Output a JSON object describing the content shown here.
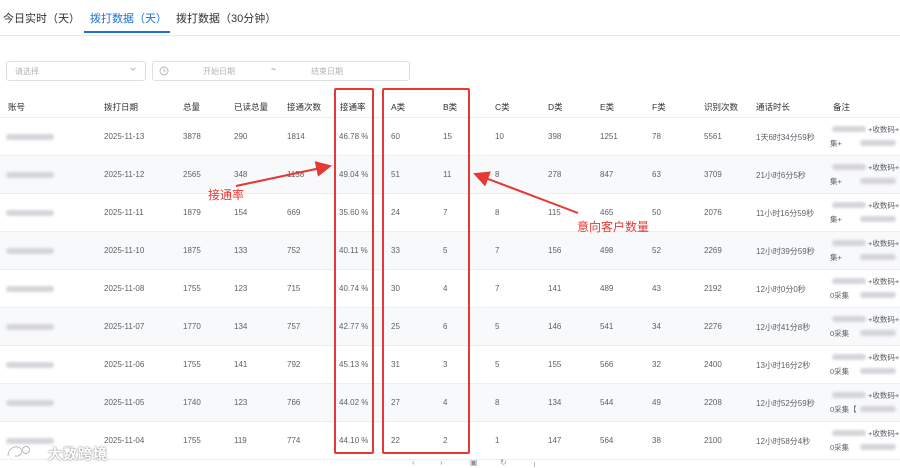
{
  "tabs": [
    {
      "label": "今日实时（天）",
      "active": false
    },
    {
      "label": "拨打数据（天）",
      "active": true
    },
    {
      "label": "拨打数据（30分钟）",
      "active": false
    }
  ],
  "filters": {
    "select_placeholder": "请选择",
    "date_start_placeholder": "开始日期",
    "date_separator": "~",
    "date_end_placeholder": "结束日期"
  },
  "table": {
    "columns": [
      "账号",
      "拨打日期",
      "总量",
      "已读总量",
      "接通次数",
      "接通率",
      "A类",
      "B类",
      "C类",
      "D类",
      "E类",
      "F类",
      "识别次数",
      "通话时长",
      "备注"
    ],
    "rows": [
      {
        "date": "2025-11-13",
        "total": "3878",
        "read": "290",
        "connected": "1814",
        "rate": "46.78 %",
        "a": "60",
        "b": "15",
        "c": "10",
        "d": "398",
        "e": "1251",
        "f": "78",
        "recog": "5561",
        "duration": "1天6时34分59秒",
        "remark1": "+收数码+",
        "remark2": "集+"
      },
      {
        "date": "2025-11-12",
        "total": "2565",
        "read": "348",
        "connected": "1158",
        "rate": "49.04 %",
        "a": "51",
        "b": "11",
        "c": "8",
        "d": "278",
        "e": "847",
        "f": "63",
        "recog": "3709",
        "duration": "21小时6分5秒",
        "remark1": "+收数码+",
        "remark2": "集+"
      },
      {
        "date": "2025-11-11",
        "total": "1879",
        "read": "154",
        "connected": "669",
        "rate": "35.60 %",
        "a": "24",
        "b": "7",
        "c": "8",
        "d": "115",
        "e": "465",
        "f": "50",
        "recog": "2076",
        "duration": "11小时16分59秒",
        "remark1": "+收数码+",
        "remark2": "集+"
      },
      {
        "date": "2025-11-10",
        "total": "1875",
        "read": "133",
        "connected": "752",
        "rate": "40.11 %",
        "a": "33",
        "b": "5",
        "c": "7",
        "d": "156",
        "e": "498",
        "f": "52",
        "recog": "2269",
        "duration": "12小时39分59秒",
        "remark1": "+收数码+",
        "remark2": "集+"
      },
      {
        "date": "2025-11-08",
        "total": "1755",
        "read": "123",
        "connected": "715",
        "rate": "40.74 %",
        "a": "30",
        "b": "4",
        "c": "7",
        "d": "141",
        "e": "489",
        "f": "43",
        "recog": "2192",
        "duration": "12小时0分0秒",
        "remark1": "+收数码+",
        "remark2": "0采集"
      },
      {
        "date": "2025-11-07",
        "total": "1770",
        "read": "134",
        "connected": "757",
        "rate": "42.77 %",
        "a": "25",
        "b": "6",
        "c": "5",
        "d": "146",
        "e": "541",
        "f": "34",
        "recog": "2276",
        "duration": "12小时41分8秒",
        "remark1": "+收数码+",
        "remark2": "0采集"
      },
      {
        "date": "2025-11-06",
        "total": "1755",
        "read": "141",
        "connected": "792",
        "rate": "45.13 %",
        "a": "31",
        "b": "3",
        "c": "5",
        "d": "155",
        "e": "566",
        "f": "32",
        "recog": "2400",
        "duration": "13小时16分2秒",
        "remark1": "+收数码+",
        "remark2": "0采集"
      },
      {
        "date": "2025-11-05",
        "total": "1740",
        "read": "123",
        "connected": "766",
        "rate": "44.02 %",
        "a": "27",
        "b": "4",
        "c": "8",
        "d": "134",
        "e": "544",
        "f": "49",
        "recog": "2208",
        "duration": "12小时52分59秒",
        "remark1": "+收数码+",
        "remark2": "0采集【"
      },
      {
        "date": "2025-11-04",
        "total": "1755",
        "read": "119",
        "connected": "774",
        "rate": "44.10 %",
        "a": "22",
        "b": "2",
        "c": "1",
        "d": "147",
        "e": "564",
        "f": "38",
        "recog": "2100",
        "duration": "12小时58分4秒",
        "remark1": "+收数码+",
        "remark2": "0采集"
      }
    ]
  },
  "annotations": {
    "rate_label": "接通率",
    "intent_label": "意向客户数量",
    "color": "#e53935"
  },
  "watermark": {
    "text": "大数跨境"
  },
  "colors": {
    "accent": "#1f6fd9",
    "highlight": "#e53935"
  }
}
